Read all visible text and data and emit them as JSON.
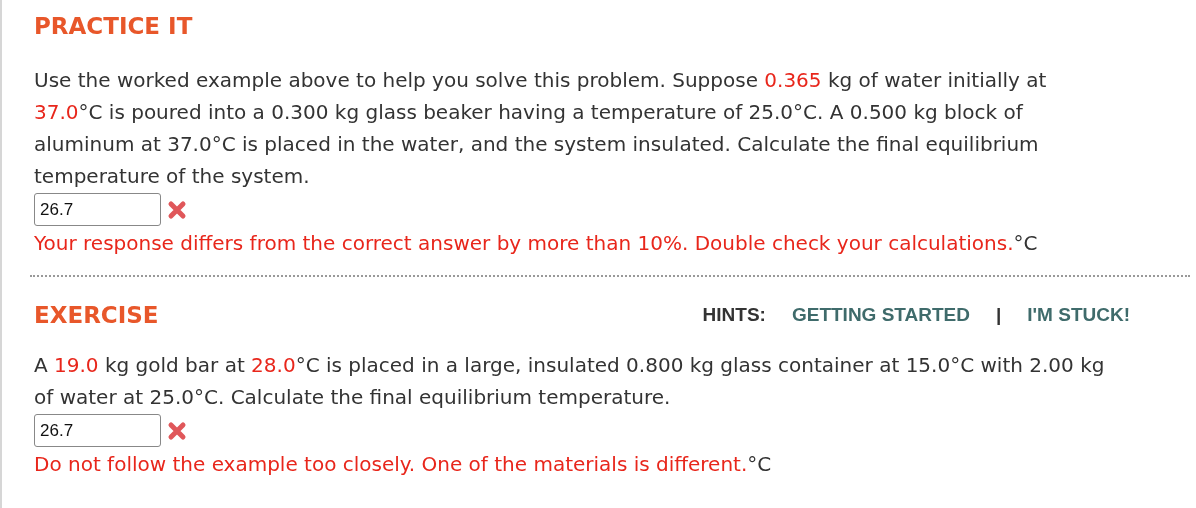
{
  "sections": [
    {
      "title": "PRACTICE IT",
      "problem": [
        {
          "text": "Use the worked example above to help you solve this problem. Suppose ",
          "highlight": false
        },
        {
          "text": "0.365",
          "highlight": true
        },
        {
          "text": " kg of water initially at ",
          "highlight": false
        },
        {
          "text": "37.0",
          "highlight": true
        },
        {
          "text": "°C is poured into a 0.300 kg glass beaker having a temperature of 25.0°C. A 0.500 kg block of aluminum at 37.0°C is placed in the water, and the system insulated. Calculate the final equilibrium temperature of the system.",
          "highlight": false
        }
      ],
      "answer": {
        "value": "26.7",
        "correct": false
      },
      "feedback": [
        {
          "text": "Your response differs from the correct answer by more than 10%. Double check your calculations.",
          "highlight": true
        },
        {
          "text": "°C",
          "highlight": false
        }
      ]
    },
    {
      "title": "EXERCISE",
      "hints": {
        "label": "HINTS:",
        "links": [
          "GETTING STARTED",
          "I'M STUCK!"
        ],
        "separator": "|"
      },
      "problem": [
        {
          "text": "A ",
          "highlight": false
        },
        {
          "text": "19.0",
          "highlight": true
        },
        {
          "text": " kg gold bar at ",
          "highlight": false
        },
        {
          "text": "28.0",
          "highlight": true
        },
        {
          "text": "°C is placed in a large, insulated 0.800 kg glass container at 15.0°C with 2.00 kg of water at 25.0°C. Calculate the final equilibrium temperature.",
          "highlight": false
        }
      ],
      "answer": {
        "value": "26.7",
        "correct": false
      },
      "feedback": [
        {
          "text": "Do not follow the example too closely. One of the materials is different.",
          "highlight": true
        },
        {
          "text": "°C",
          "highlight": false
        }
      ]
    }
  ]
}
